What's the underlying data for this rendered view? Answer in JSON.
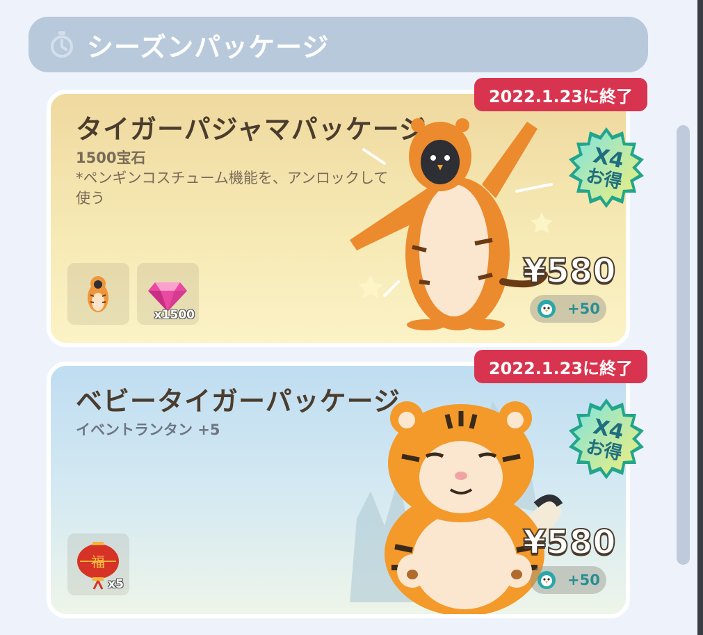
{
  "header": {
    "title": "シーズンパッケージ",
    "icon": "stopwatch-icon"
  },
  "packages": [
    {
      "title": "タイガーパジャマパッケージ",
      "desc_line1": "1500宝石",
      "desc_line2": "*ペンギンコスチューム機能を、アンロックして",
      "desc_line3": "使う",
      "deadline": "2022.1.23に終了",
      "badge_mult": "X4",
      "badge_label": "お得",
      "price": "¥580",
      "bonus": "+50",
      "items": [
        {
          "icon": "tiger-costume-icon",
          "qty": ""
        },
        {
          "icon": "gem-icon",
          "qty": "x1500"
        }
      ]
    },
    {
      "title": "ベビータイガーパッケージ",
      "desc_line1": "イベントランタン +5",
      "deadline": "2022.1.23に終了",
      "badge_mult": "X4",
      "badge_label": "お得",
      "price": "¥580",
      "bonus": "+50",
      "items": [
        {
          "icon": "lantern-icon",
          "qty": "x5"
        }
      ]
    }
  ],
  "colors": {
    "deadline": "#d8344f",
    "badge_text": "#1f6e7f",
    "bonus_text": "#2a8e93"
  }
}
